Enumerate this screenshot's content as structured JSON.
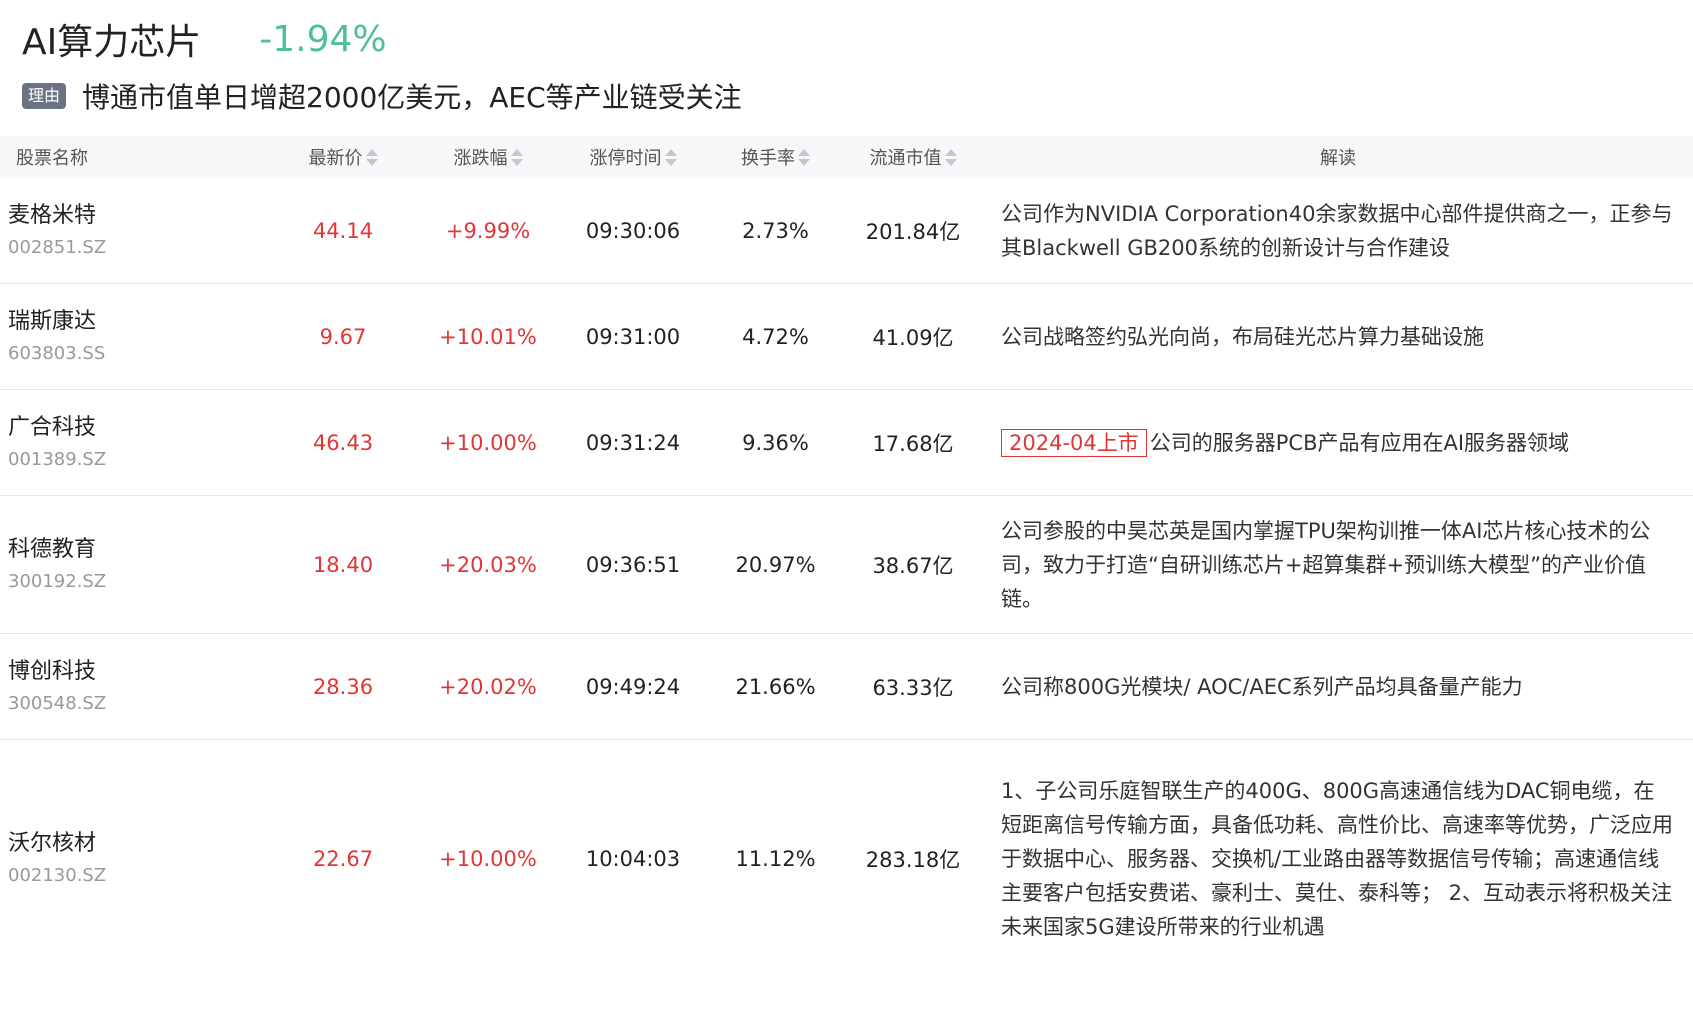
{
  "sector": {
    "name": "AI算力芯片",
    "change": "-1.94%"
  },
  "reason": {
    "tag": "理由",
    "text": "博通市值单日增超2000亿美元，AEC等产业链受关注"
  },
  "columns": {
    "name": "股票名称",
    "price": "最新价",
    "change": "涨跌幅",
    "limit_time": "涨停时间",
    "turnover": "换手率",
    "market_cap": "流通市值",
    "note": "解读"
  },
  "colors": {
    "up": "#e03636",
    "down": "#4fbf97",
    "tag_bg": "#6b7385",
    "header_bg": "#f6f7f9"
  },
  "rows": [
    {
      "name": "麦格米特",
      "code": "002851.SZ",
      "price": "44.14",
      "change": "+9.99%",
      "limit_time": "09:30:06",
      "turnover": "2.73%",
      "market_cap": "201.84亿",
      "badge": "",
      "note": "公司作为NVIDIA Corporation40余家数据中心部件提供商之一，正参与其Blackwell GB200系统的创新设计与合作建设"
    },
    {
      "name": "瑞斯康达",
      "code": "603803.SS",
      "price": "9.67",
      "change": "+10.01%",
      "limit_time": "09:31:00",
      "turnover": "4.72%",
      "market_cap": "41.09亿",
      "badge": "",
      "note": "公司战略签约弘光向尚，布局硅光芯片算力基础设施"
    },
    {
      "name": "广合科技",
      "code": "001389.SZ",
      "price": "46.43",
      "change": "+10.00%",
      "limit_time": "09:31:24",
      "turnover": "9.36%",
      "market_cap": "17.68亿",
      "badge": "2024-04上市",
      "note": "公司的服务器PCB产品有应用在AI服务器领域"
    },
    {
      "name": "科德教育",
      "code": "300192.SZ",
      "price": "18.40",
      "change": "+20.03%",
      "limit_time": "09:36:51",
      "turnover": "20.97%",
      "market_cap": "38.67亿",
      "badge": "",
      "note": "公司参股的中昊芯英是国内掌握TPU架构训推一体AI芯片核心技术的公司，致力于打造“自研训练芯片+超算集群+预训练大模型”的产业价值链。"
    },
    {
      "name": "博创科技",
      "code": "300548.SZ",
      "price": "28.36",
      "change": "+20.02%",
      "limit_time": "09:49:24",
      "turnover": "21.66%",
      "market_cap": "63.33亿",
      "badge": "",
      "note": "公司称800G光模块/ AOC/AEC系列产品均具备量产能力"
    },
    {
      "name": "沃尔核材",
      "code": "002130.SZ",
      "price": "22.67",
      "change": "+10.00%",
      "limit_time": "10:04:03",
      "turnover": "11.12%",
      "market_cap": "283.18亿",
      "badge": "",
      "note": "1、子公司乐庭智联生产的400G、800G高速通信线为DAC铜电缆，在短距离信号传输方面，具备低功耗、高性价比、高速率等优势，广泛应用于数据中心、服务器、交换机/工业路由器等数据信号传输；高速通信线主要客户包括安费诺、豪利士、莫仕、泰科等； 2、互动表示将积极关注未来国家5G建设所带来的行业机遇"
    }
  ]
}
